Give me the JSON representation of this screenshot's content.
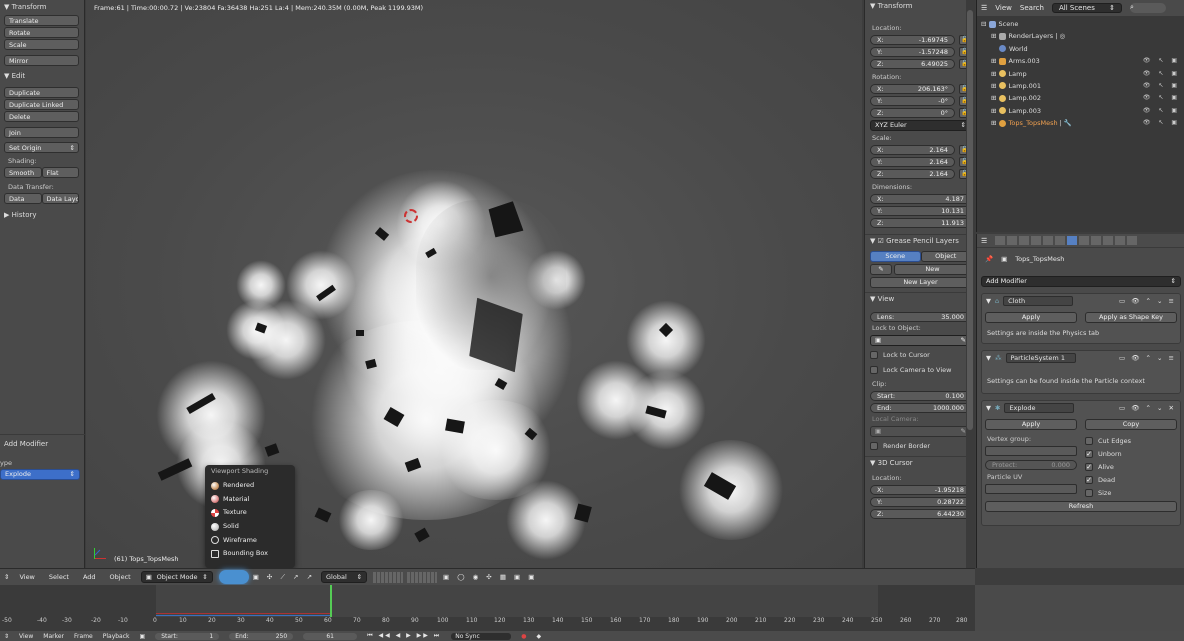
{
  "toolshelf": {
    "transform_title": "Transform",
    "translate": "Translate",
    "rotate": "Rotate",
    "scale": "Scale",
    "mirror": "Mirror",
    "edit_title": "Edit",
    "duplicate": "Duplicate",
    "duplicate_linked": "Duplicate Linked",
    "delete": "Delete",
    "join": "Join",
    "set_origin": "Set Origin",
    "shading_label": "Shading:",
    "smooth": "Smooth",
    "flat": "Flat",
    "data_transfer_label": "Data Transfer:",
    "data": "Data",
    "data_layo": "Data Layo",
    "history": "History",
    "add_modifier_title": "Add Modifier",
    "type_label": "ype",
    "type_value": "Explode"
  },
  "viewport": {
    "info": "Frame:61 | Time:00:00.72 | Ve:23804 Fa:36438 Ha:251 La:4 | Mem:240.35M (0.00M, Peak 1199.93M)",
    "object_label": "(61) Tops_TopsMesh"
  },
  "shading_popup": {
    "title": "Viewport Shading",
    "items": [
      "Rendered",
      "Material",
      "Texture",
      "Solid",
      "Wireframe",
      "Bounding Box"
    ]
  },
  "props": {
    "transform": "Transform",
    "location": "Location:",
    "loc": [
      [
        "X:",
        "-1.69745"
      ],
      [
        "Y:",
        "-1.57248"
      ],
      [
        "Z:",
        "6.49025"
      ]
    ],
    "rotation": "Rotation:",
    "rot": [
      [
        "X:",
        "206.163°"
      ],
      [
        "Y:",
        "-0°"
      ],
      [
        "Z:",
        "0°"
      ]
    ],
    "rot_mode": "XYZ Euler",
    "scale": "Scale:",
    "scl": [
      [
        "X:",
        "2.164"
      ],
      [
        "Y:",
        "2.164"
      ],
      [
        "Z:",
        "2.164"
      ]
    ],
    "dimensions": "Dimensions:",
    "dim": [
      [
        "X:",
        "4.187"
      ],
      [
        "Y:",
        "10.131"
      ],
      [
        "Z:",
        "11.913"
      ]
    ],
    "gp_title": "Grease Pencil Layers",
    "scene_tab": "Scene",
    "object_tab": "Object",
    "new_btn": "New",
    "new_layer": "New Layer",
    "view_title": "View",
    "lens_label": "Lens:",
    "lens_value": "35.000",
    "lock_to_object": "Lock to Object:",
    "lock_to_cursor": "Lock to Cursor",
    "lock_camera": "Lock Camera to View",
    "clip": "Clip:",
    "clip_start": [
      "Start:",
      "0.100"
    ],
    "clip_end": [
      "End:",
      "1000.000"
    ],
    "local_camera": "Local Camera:",
    "render_border": "Render Border",
    "cursor_title": "3D Cursor",
    "cursor_location": "Location:",
    "cur": [
      [
        "X:",
        "-1.95218"
      ],
      [
        "Y:",
        "0.28722"
      ],
      [
        "Z:",
        "6.44230"
      ]
    ]
  },
  "outliner": {
    "view": "View",
    "search": "Search",
    "scenes": "All Scenes",
    "rows": [
      "Scene",
      "RenderLayers",
      "World",
      "Arms.003",
      "Lamp",
      "Lamp.001",
      "Lamp.002",
      "Lamp.003",
      "Tops_TopsMesh"
    ]
  },
  "propedit": {
    "object_name": "Tops_TopsMesh",
    "add_modifier": "Add Modifier",
    "cloth_name": "Cloth",
    "apply": "Apply",
    "apply_shape_key": "Apply as Shape Key",
    "cloth_note": "Settings are inside the Physics tab",
    "ps_name": "ParticleSystem 1",
    "ps_note": "Settings can be found inside the Particle context",
    "explode_name": "Explode",
    "copy": "Copy",
    "vertex_group": "Vertex group:",
    "protect": "Protect:",
    "protect_value": "0.000",
    "particle_uv": "Particle UV",
    "cut_edges": "Cut Edges",
    "unborn": "Unborn",
    "alive": "Alive",
    "dead": "Dead",
    "size": "Size",
    "refresh": "Refresh"
  },
  "header3d": {
    "view": "View",
    "select": "Select",
    "add": "Add",
    "object": "Object",
    "mode": "Object Mode",
    "orientation": "Global"
  },
  "timeline": {
    "ticks": [
      "-50",
      "-40",
      "-30",
      "-20",
      "-10",
      "0",
      "10",
      "20",
      "30",
      "40",
      "50",
      "60",
      "70",
      "80",
      "90",
      "100",
      "110",
      "120",
      "130",
      "140",
      "150",
      "160",
      "170",
      "180",
      "190",
      "200",
      "210",
      "220",
      "230",
      "240",
      "250",
      "260",
      "270",
      "280"
    ],
    "view": "View",
    "marker": "Marker",
    "frame": "Frame",
    "playback": "Playback",
    "start_label": "Start:",
    "start": "1",
    "end_label": "End:",
    "end": "250",
    "current": "61",
    "sync": "No Sync"
  }
}
